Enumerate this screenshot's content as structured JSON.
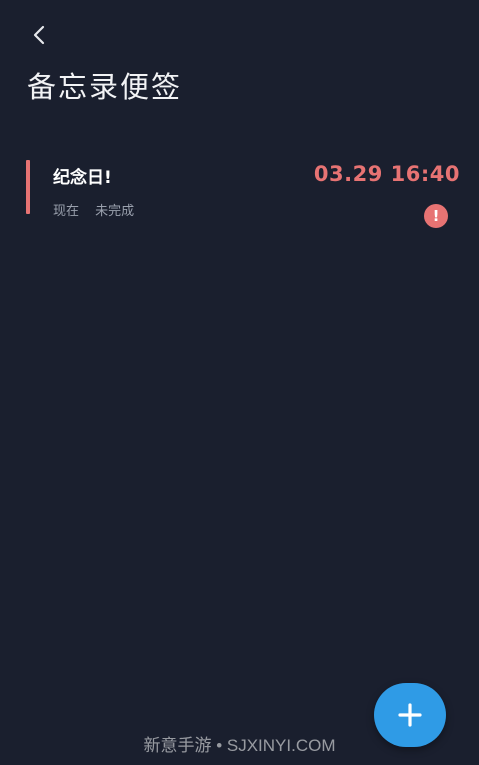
{
  "header": {
    "back_icon": "chevron-left-icon",
    "title": "备忘录便签"
  },
  "memos": [
    {
      "title": "纪念日!",
      "time_label": "现在",
      "status": "未完成",
      "datetime": "03.29 16:40",
      "alert_icon": "exclamation-circle-icon",
      "alert_glyph": "!",
      "accent_color": "#e77373"
    }
  ],
  "fab": {
    "icon": "plus-icon",
    "color": "#2f9be6"
  },
  "watermark": {
    "text": "新意手游 • SJXINYI.COM"
  },
  "colors": {
    "background": "#1a1f2e",
    "accent": "#e77373"
  }
}
